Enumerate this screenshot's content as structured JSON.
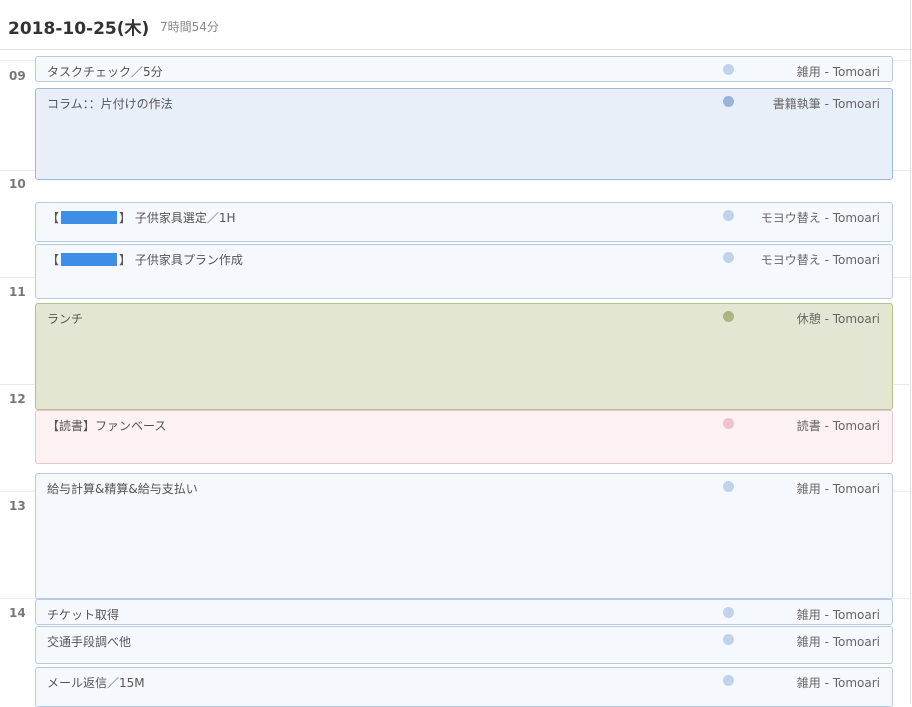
{
  "header": {
    "date": "2018-10-25(木)",
    "duration": "7時間54分"
  },
  "hours": [
    "09",
    "10",
    "11",
    "12",
    "13",
    "14"
  ],
  "events": [
    {
      "title": "タスクチェック／5分",
      "category": "雑用 - Tomoari",
      "dot": "#c0d3ea"
    },
    {
      "title": "コラム：：片付けの作法",
      "category": "書籍執筆 - Tomoari",
      "dot": "#9bb3d8"
    },
    {
      "title_prefix": "【",
      "title_suffix": "】 子供家具選定／1H",
      "category": "モヨウ替え - Tomoari",
      "dot": "#c0d3ea"
    },
    {
      "title_prefix": "【",
      "title_suffix": "】 子供家具プラン作成",
      "category": "モヨウ替え - Tomoari",
      "dot": "#c0d3ea"
    },
    {
      "title": "ランチ",
      "category": "休憩 - Tomoari",
      "dot": "#aab57f"
    },
    {
      "title": "【読書】ファンベース",
      "category": "読書 - Tomoari",
      "dot": "#eec3d0"
    },
    {
      "title": "給与計算&精算&給与支払い",
      "category": "雑用 - Tomoari",
      "dot": "#c0d3ea"
    },
    {
      "title": "チケット取得",
      "category": "雑用 - Tomoari",
      "dot": "#c0d3ea"
    },
    {
      "title": "交通手段調べ他",
      "category": "雑用 - Tomoari",
      "dot": "#c0d3ea"
    },
    {
      "title": "メール返信／15M",
      "category": "雑用 - Tomoari",
      "dot": "#c0d3ea"
    }
  ],
  "colors": {
    "accent_redaction": "#3d8fe6"
  }
}
